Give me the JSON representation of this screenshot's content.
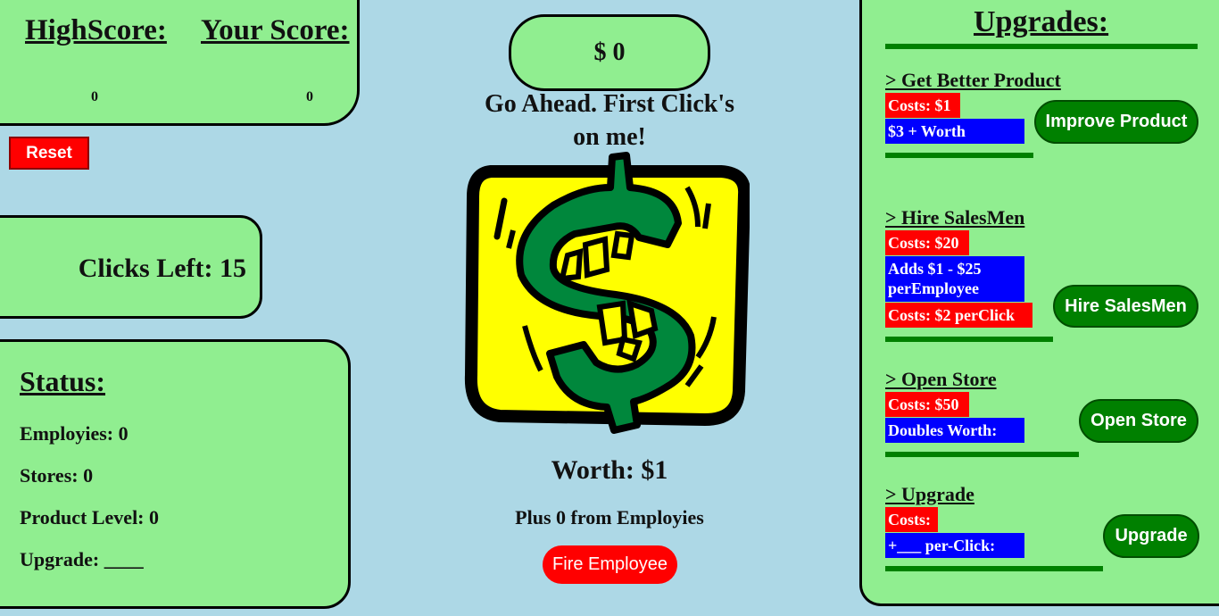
{
  "score": {
    "highscore_label": "HighScore:",
    "yourscore_label": "Your Score:",
    "highscore_value": "0",
    "yourscore_value": "0"
  },
  "reset_label": "Reset",
  "clicks_left": "Clicks Left: 15",
  "status": {
    "title": "Status:",
    "lines": [
      "Employies: 0",
      "Stores: 0",
      "Product Level: 0",
      "Upgrade: ____"
    ]
  },
  "money": "$ 0",
  "message": "Go Ahead. First Click's on me!",
  "worth": "Worth: $1",
  "plus": "Plus 0 from Employies",
  "fire_label": "Fire Employee",
  "upgrades": {
    "title": "Upgrades:",
    "items": [
      {
        "heading": "> Get Better Product",
        "cost": "Costs: $1",
        "desc": "$3 + Worth",
        "button": "Improve Product"
      },
      {
        "heading": "> Hire SalesMen",
        "cost": "Costs: $20",
        "desc": "Adds $1 - $25 perEmployee",
        "extra": "Costs: $2 perClick",
        "button": "Hire SalesMen"
      },
      {
        "heading": "> Open Store",
        "cost": "Costs: $50",
        "desc": "Doubles Worth:",
        "button": "Open Store"
      },
      {
        "heading": "> Upgrade",
        "cost": "Costs:",
        "desc": "+___ per-Click:",
        "button": "Upgrade"
      }
    ]
  },
  "colors": {
    "background": "#add8e6",
    "panel": "#90ee90",
    "green": "#008000",
    "red": "#ff0000",
    "blue": "#0000ff",
    "dollar_yellow": "#ffff00",
    "dollar_green": "#00873c"
  },
  "icons": {
    "click_target": "dollar-sign-icon"
  }
}
